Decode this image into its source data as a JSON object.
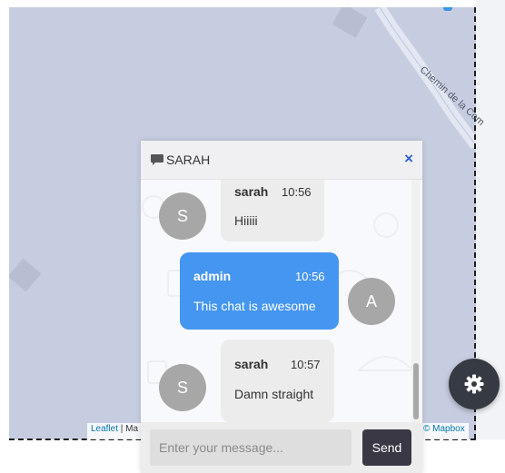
{
  "map": {
    "road_label": "Chemin de la Com",
    "attribution_left_link": "Leaflet",
    "attribution_left_rest": " | Ma",
    "attribution_right": "© Mapbox"
  },
  "chat": {
    "header_title": "SARAH",
    "close_symbol": "×",
    "messages": [
      {
        "author": "sarah",
        "time": "10:56",
        "text": "Hiiiii",
        "avatar": "S",
        "direction": "incoming"
      },
      {
        "author": "admin",
        "time": "10:56",
        "text": "This chat is awesome",
        "avatar": "A",
        "direction": "outgoing"
      },
      {
        "author": "sarah",
        "time": "10:57",
        "text": "Damn straight",
        "avatar": "S",
        "direction": "incoming"
      }
    ],
    "input_placeholder": "Enter your message...",
    "send_label": "Send"
  },
  "icons": {
    "header_icon": "chat-bubble-icon",
    "fab_icon": "gear-icon"
  },
  "colors": {
    "outgoing_bubble": "#4596f0",
    "incoming_bubble": "#ececec",
    "send_button": "#3a3845",
    "close_icon": "#2c64d8",
    "fab": "#363a42"
  }
}
